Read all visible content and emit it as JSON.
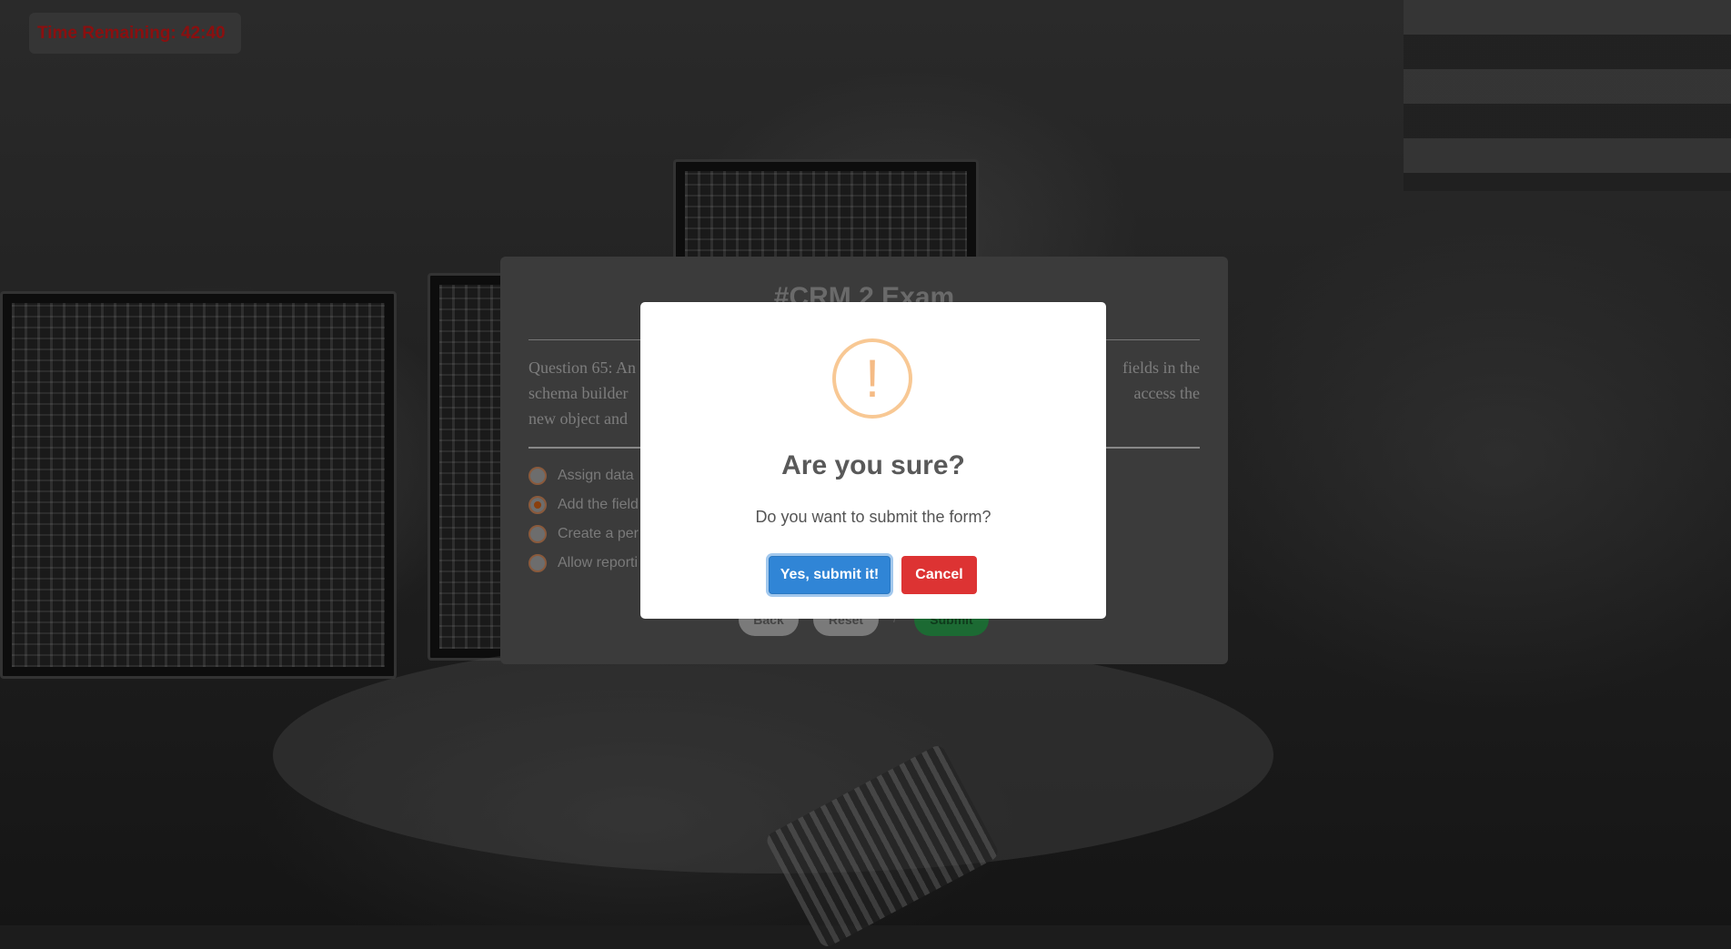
{
  "timer": {
    "text": "Time Remaining: 42:40"
  },
  "exam": {
    "title": "#CRM 2 Exam",
    "question_line1_left": "Question 65: An",
    "question_line1_right": "fields in the",
    "question_line2_left": "schema builder",
    "question_line2_right": "access the",
    "question_line3_left": "new object and",
    "options": [
      {
        "label": "Assign data",
        "checked": false
      },
      {
        "label": "Add the field",
        "checked": true
      },
      {
        "label": "Create a per",
        "checked": false
      },
      {
        "label": "Allow reporti",
        "checked": false
      }
    ],
    "buttons": {
      "back": "Back",
      "reset": "Reset",
      "separator": "/",
      "submit": "Submit"
    }
  },
  "modal": {
    "icon": "warning-exclamation-icon",
    "icon_glyph": "!",
    "title": "Are you sure?",
    "text": "Do you want to submit the form?",
    "confirm_label": "Yes, submit it!",
    "cancel_label": "Cancel",
    "colors": {
      "confirm": "#3085d6",
      "cancel": "#dd3333",
      "icon": "#f8bb86"
    }
  }
}
